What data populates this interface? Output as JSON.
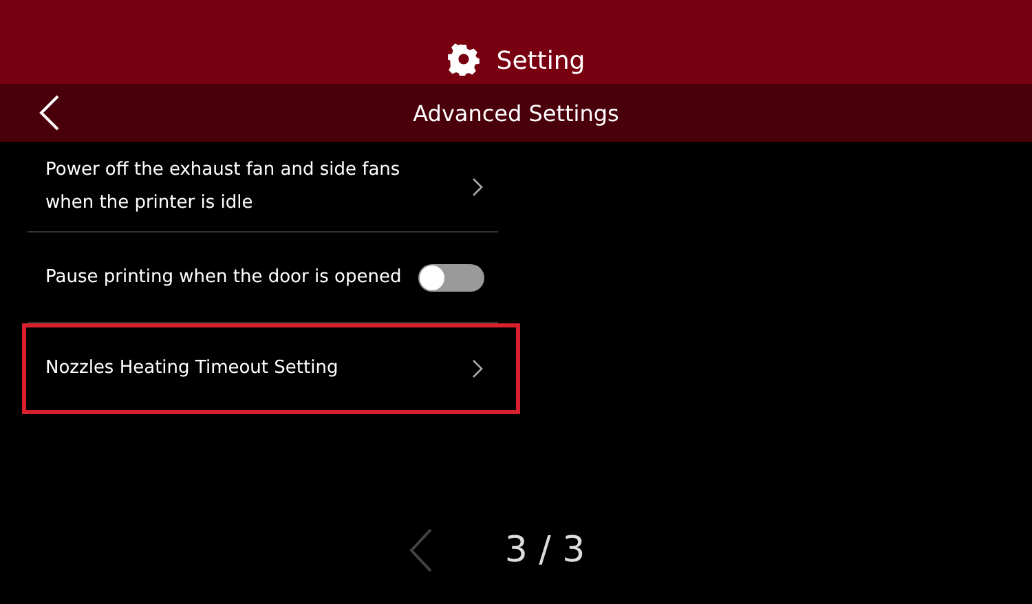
{
  "header": {
    "title": "Setting"
  },
  "subheader": {
    "title": "Advanced Settings"
  },
  "settings": [
    {
      "kind": "link",
      "label": "Power off the exhaust fan and side fans when the printer is idle",
      "highlighted": false
    },
    {
      "kind": "toggle",
      "label": "Pause printing when the door is opened",
      "on": false,
      "highlighted": false
    },
    {
      "kind": "link",
      "label": "Nozzles Heating Timeout Setting",
      "highlighted": true
    }
  ],
  "pager": {
    "page": "3 / 3",
    "prev_disabled": true
  }
}
